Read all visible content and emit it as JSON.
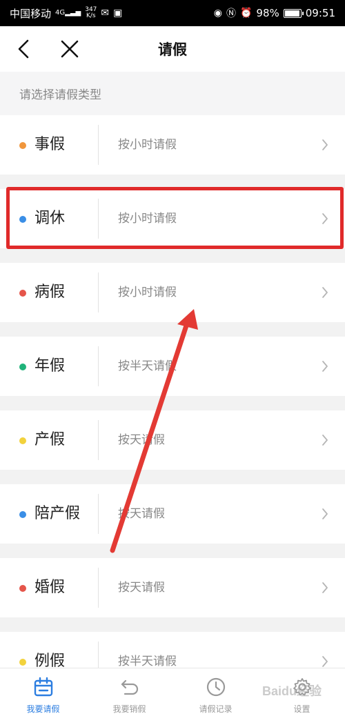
{
  "status_bar": {
    "carrier": "中国移动",
    "network": "4G",
    "speed_value": "347",
    "speed_unit": "K/s",
    "battery": "98%",
    "battery_level": 0.98,
    "time": "09:51"
  },
  "header": {
    "title": "请假"
  },
  "section": {
    "label": "请选择请假类型"
  },
  "leave_types": [
    {
      "name": "事假",
      "unit": "按小时请假",
      "dot_color": "#f0963c"
    },
    {
      "name": "调休",
      "unit": "按小时请假",
      "dot_color": "#3a8ee6"
    },
    {
      "name": "病假",
      "unit": "按小时请假",
      "dot_color": "#e5554a"
    },
    {
      "name": "年假",
      "unit": "按半天请假",
      "dot_color": "#1fb37a"
    },
    {
      "name": "产假",
      "unit": "按天请假",
      "dot_color": "#f2d23c"
    },
    {
      "name": "陪产假",
      "unit": "按天请假",
      "dot_color": "#3a8ee6"
    },
    {
      "name": "婚假",
      "unit": "按天请假",
      "dot_color": "#e5554a"
    },
    {
      "name": "例假",
      "unit": "按半天请假",
      "dot_color": "#f2d23c"
    }
  ],
  "tabs": [
    {
      "label": "我要请假",
      "icon": "calendar-icon",
      "active": true
    },
    {
      "label": "我要销假",
      "icon": "undo-icon",
      "active": false
    },
    {
      "label": "请假记录",
      "icon": "clock-icon",
      "active": false
    },
    {
      "label": "设置",
      "icon": "gear-icon",
      "active": false
    }
  ],
  "colors": {
    "accent": "#2b7de0",
    "highlight": "#e02a2a"
  },
  "watermark": "Baidu经验"
}
